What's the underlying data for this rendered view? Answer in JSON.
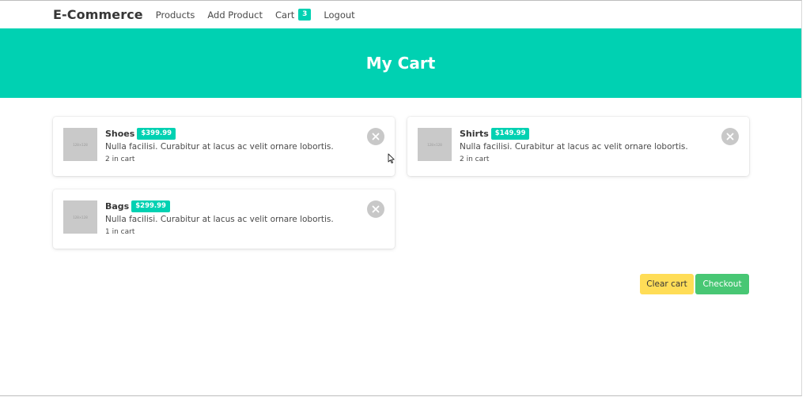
{
  "navbar": {
    "brand": "E-Commerce",
    "links": {
      "products": "Products",
      "add_product": "Add Product",
      "cart": "Cart",
      "cart_count": "3",
      "logout": "Logout"
    }
  },
  "hero": {
    "title": "My Cart"
  },
  "cart_items": [
    {
      "name": "Shoes",
      "price": "$399.99",
      "description": "Nulla facilisi. Curabitur at lacus ac velit ornare lobortis.",
      "quantity": "2 in cart",
      "thumb_text": "128×128"
    },
    {
      "name": "Shirts",
      "price": "$149.99",
      "description": "Nulla facilisi. Curabitur at lacus ac velit ornare lobortis.",
      "quantity": "2 in cart",
      "thumb_text": "128×128"
    },
    {
      "name": "Bags",
      "price": "$299.99",
      "description": "Nulla facilisi. Curabitur at lacus ac velit ornare lobortis.",
      "quantity": "1 in cart",
      "thumb_text": "128×128"
    }
  ],
  "actions": {
    "clear_cart": "Clear cart",
    "checkout": "Checkout"
  },
  "colors": {
    "primary": "#00d1b2",
    "warning": "#ffdd57",
    "success": "#48c774",
    "remove": "#c8c8c8"
  },
  "icons": {
    "remove": "close-icon",
    "cursor": "mouse-pointer-icon"
  }
}
